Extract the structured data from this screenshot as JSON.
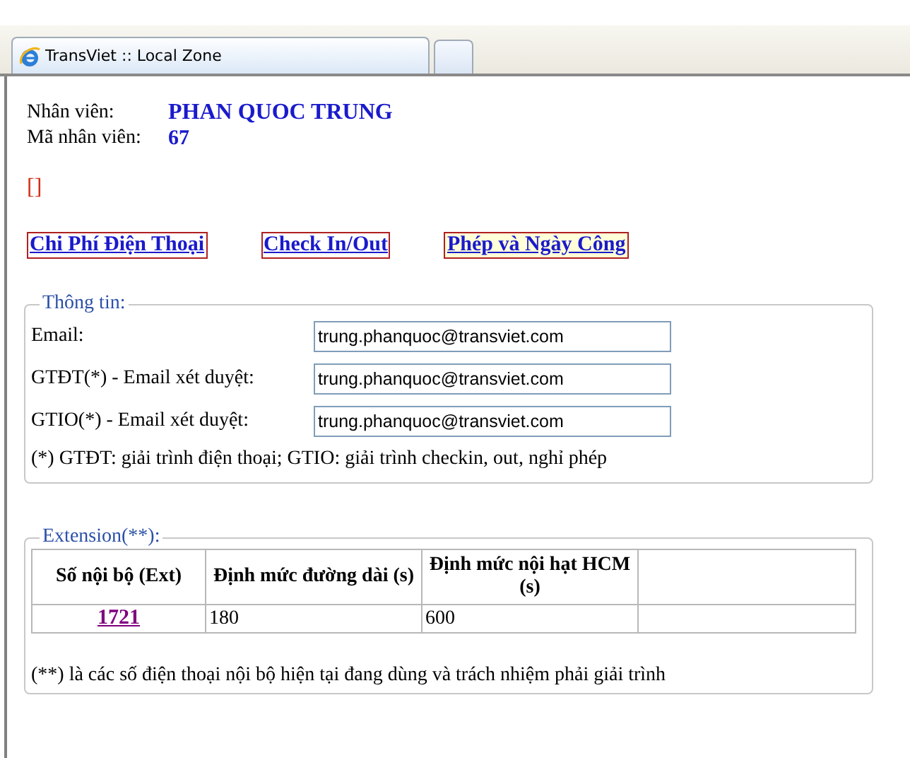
{
  "browser": {
    "tab_title": "TransViet :: Local Zone"
  },
  "employee": {
    "name_label": "Nhân viên:",
    "name": "PHAN QUOC TRUNG",
    "id_label": "Mã nhân viên:",
    "id": "67"
  },
  "marker": "[]",
  "nav_links": [
    {
      "label": "Chi Phí Điện Thoại",
      "highlighted": false
    },
    {
      "label": "Check In/Out",
      "highlighted": false
    },
    {
      "label": "Phép và Ngày Công",
      "highlighted": true
    }
  ],
  "info": {
    "legend": "Thông tin:",
    "fields": [
      {
        "label": "Email:",
        "value": "trung.phanquoc@transviet.com"
      },
      {
        "label": "GTĐT(*) - Email xét duyệt:",
        "value": "trung.phanquoc@transviet.com"
      },
      {
        "label": "GTIO(*) - Email xét duyệt:",
        "value": "trung.phanquoc@transviet.com"
      }
    ],
    "note": "(*) GTĐT: giải trình điện thoại; GTIO: giải trình checkin, out, nghỉ phép"
  },
  "extension": {
    "legend": "Extension(**):",
    "columns": [
      "Số nội bộ (Ext)",
      "Định mức đường dài (s)",
      "Định mức nội hạt HCM (s)"
    ],
    "rows": [
      {
        "ext": "1721",
        "long_distance": "180",
        "local": "600"
      }
    ],
    "note": "(**) là các số điện thoại nội bộ hiện tại đang dùng và trách nhiệm phải giải trình"
  }
}
